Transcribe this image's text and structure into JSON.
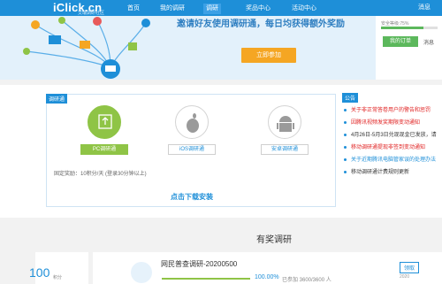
{
  "header": {
    "logo": "iClick.cn",
    "logo_sub": "艾瑞调研社区",
    "nav": [
      "首页",
      "我的调研",
      "调研",
      "奖品中心",
      "活动中心"
    ],
    "user": "消息"
  },
  "hero": {
    "slogan": "邀请好友使用调研通，每日均获得额外奖励",
    "join_button": "立即参加"
  },
  "account": {
    "safety_label": "安全等级:75%",
    "safety_value": 0.75,
    "my_orders": "我的订单",
    "messages": "消息"
  },
  "survey_panel": {
    "tag": "调研通",
    "platforms": [
      {
        "label": "PC调研通",
        "icon": "monitor-upload-icon"
      },
      {
        "label": "iOS调研通",
        "icon": "apple-icon"
      },
      {
        "label": "安卓调研通",
        "icon": "android-icon"
      }
    ],
    "reward": "固定奖励：10积分/天 (登录30分钟以上)",
    "download": "点击下载安装"
  },
  "notice": {
    "tag": "公告",
    "items": [
      {
        "text": "关于非正常答卷用户的警告和惩罚",
        "color": "#e02020"
      },
      {
        "text": "因腾讯视频发奖期限变动通知",
        "color": "#e02020"
      },
      {
        "text": "4月26日-5月3日兑现现金已发放，请",
        "color": "#333333"
      },
      {
        "text": "移动调研通提现非签到变动通知",
        "color": "#e02020"
      },
      {
        "text": "关于近期腾讯电脑管家误的处理办法",
        "color": "#1e8fd8"
      },
      {
        "text": "移动调研通计费规则更新",
        "color": "#333333"
      }
    ]
  },
  "rewards_section": {
    "title": "有奖调研",
    "points": "100",
    "points_unit": "积分",
    "url": "",
    "item": {
      "title": "网民普查调研-20200500",
      "progress": "100.00%",
      "progress_value": 1.0,
      "quota": "已参加 3600/3600 人",
      "button": "领取",
      "date": "2020"
    }
  },
  "colors": {
    "brand": "#1e8fd8",
    "accent": "#f5a623",
    "green": "#8fc446"
  }
}
